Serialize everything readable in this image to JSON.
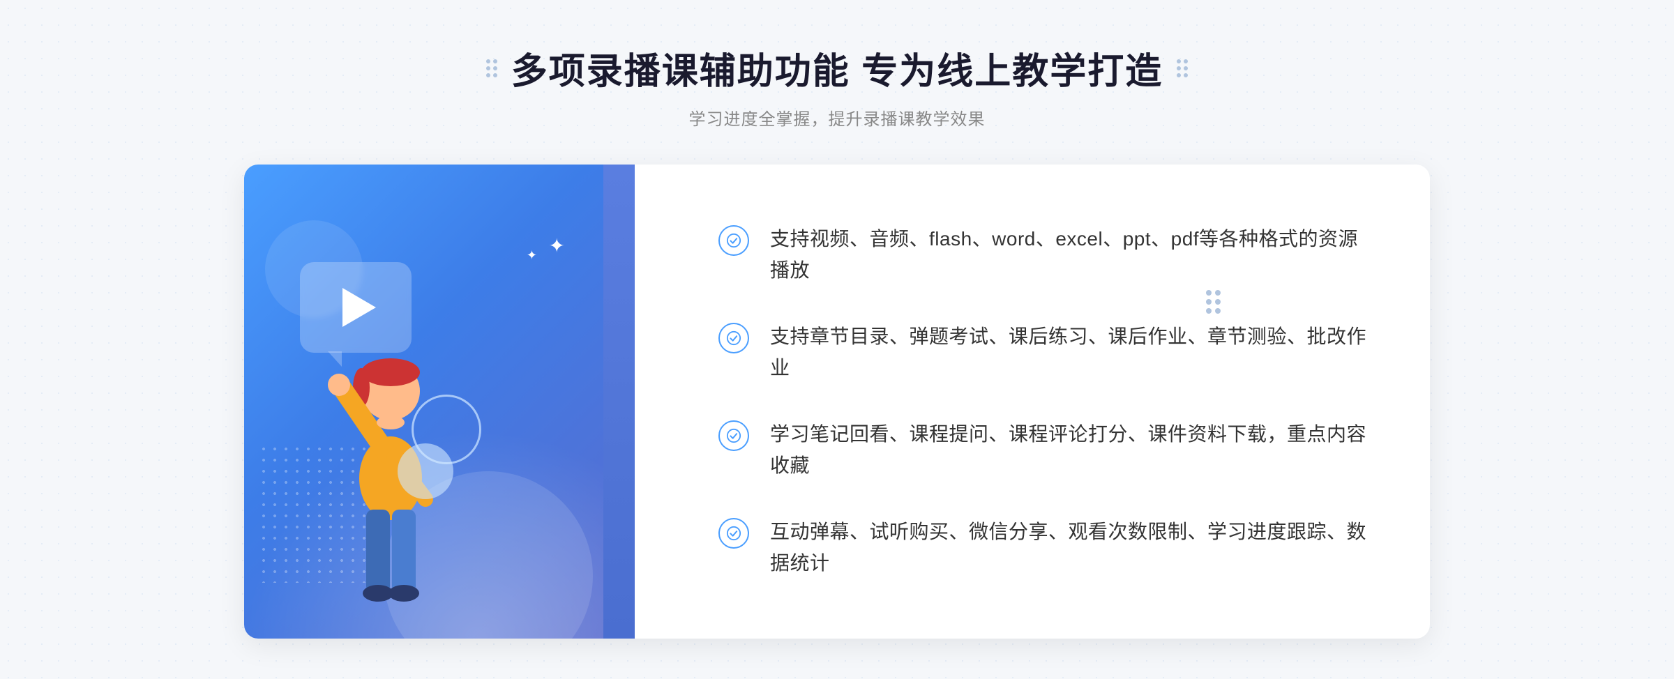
{
  "header": {
    "title": "多项录播课辅助功能 专为线上教学打造",
    "subtitle": "学习进度全掌握，提升录播课教学效果"
  },
  "features": [
    {
      "id": "feature-1",
      "text": "支持视频、音频、flash、word、excel、ppt、pdf等各种格式的资源播放"
    },
    {
      "id": "feature-2",
      "text": "支持章节目录、弹题考试、课后练习、课后作业、章节测验、批改作业"
    },
    {
      "id": "feature-3",
      "text": "学习笔记回看、课程提问、课程评论打分、课件资料下载，重点内容收藏"
    },
    {
      "id": "feature-4",
      "text": "互动弹幕、试听购买、微信分享、观看次数限制、学习进度跟踪、数据统计"
    }
  ],
  "icons": {
    "check": "check-circle-icon",
    "play": "play-icon",
    "leftArrow": "chevron-left-icon",
    "rightDots": "decoration-dots"
  },
  "colors": {
    "primary": "#4a9eff",
    "gradient_start": "#4a9eff",
    "gradient_end": "#5b6bcd",
    "text_dark": "#1a1a2e",
    "text_medium": "#333333",
    "text_light": "#888888"
  }
}
